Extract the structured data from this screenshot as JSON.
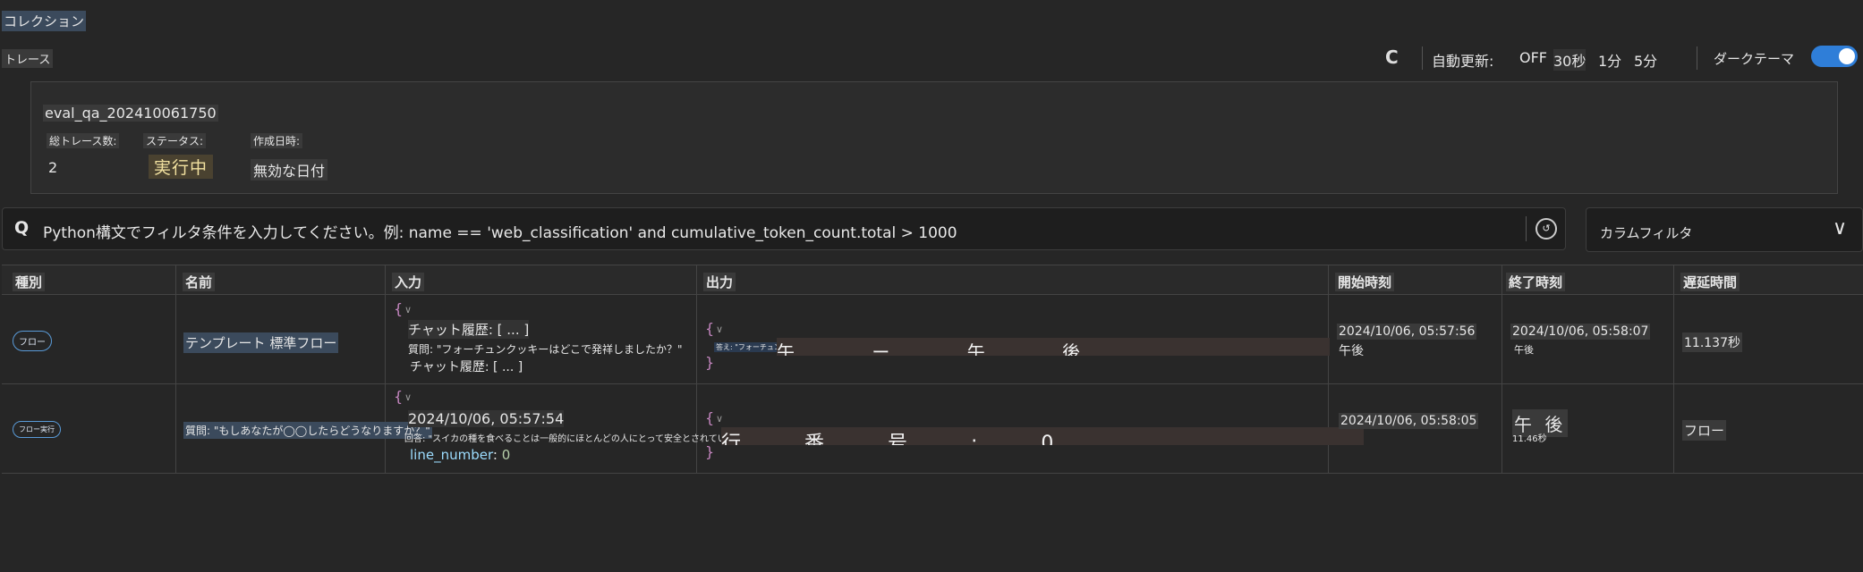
{
  "nav": {
    "collection_label": "コレクション",
    "trace_tab": "トレース"
  },
  "toolbar": {
    "refresh_icon": "C",
    "auto_refresh_label": "自動更新:",
    "intervals": [
      "OFF",
      "30秒",
      "1分",
      "5分"
    ],
    "theme_label": "ダークテーマ",
    "theme_on": true
  },
  "run": {
    "name": "eval_qa_202410061750",
    "total_traces_label": "総トレース数:",
    "total_traces": "2",
    "status_label": "ステータス:",
    "status": "実行中",
    "created_label": "作成日時:",
    "created": "無効な日付"
  },
  "filter": {
    "icon": "Q",
    "placeholder": "Python構文でフィルタ条件を入力してください。例: name == 'web_classification' and cumulative_token_count.total > 1000",
    "column_filter": "カラムフィルタ"
  },
  "table": {
    "headers": [
      "種別",
      "名前",
      "入力",
      "出力",
      "開始時刻",
      "終了時刻",
      "遅延時間"
    ],
    "rows": [
      {
        "kind": "フロー",
        "name": "テンプレート 標準フロー",
        "input_brace": "{",
        "input_line1": "チャット履歴: [ ... ]",
        "input_line2": "質問: \"フォーチュンクッキーはどこで発祥しましたか？\"",
        "input_line3": "チャット履歴: [ ... ]",
        "output_brace_open": "{",
        "output_brace_close": "}",
        "output_small": "答え: \"フォーチュンクッキー",
        "output_garbled": "午 ー 午 後",
        "start": "2024/10/06, 05:57:56",
        "start_suffix": "午後",
        "end": "2024/10/06, 05:58:07",
        "end_suffix": "午後",
        "latency": "11.137秒"
      },
      {
        "kind": "フロー実行",
        "name": "質問: \"もしあなたが◯◯したらどうなりますか？\"",
        "input_brace": "{",
        "input_line1": "2024/10/06, 05:57:54",
        "input_line2": "回答: \"スイカの種を食べることは一般的にほとんどの人にとって安全とされています...\"",
        "input_key": "line_number",
        "input_val": "0",
        "output_brace_open": "{",
        "output_brace_close": "}",
        "output_garbled": "行 番 号 : 0",
        "start": "2024/10/06, 05:58:05",
        "end": "午 後",
        "end_sub": "11.46秒",
        "latency": "フロー"
      }
    ]
  }
}
